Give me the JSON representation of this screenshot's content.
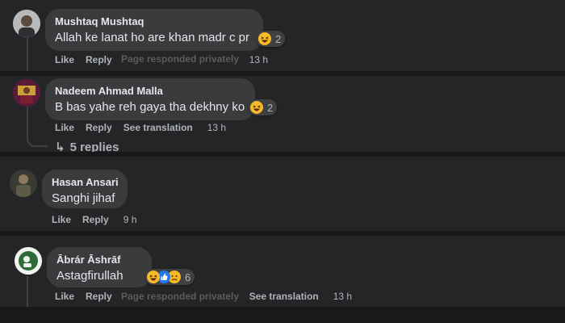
{
  "comments": [
    {
      "author": "Mushtaq Mushtaq",
      "text": "Allah ke lanat ho are khan madr c pr",
      "reaction_count": "2",
      "actions": {
        "like": "Like",
        "reply": "Reply",
        "time": "13 h"
      },
      "ghost": "Page responded privately"
    },
    {
      "author": "Nadeem Ahmad Malla",
      "text": "B bas yahe reh gaya tha dekhny ko",
      "reaction_count": "2",
      "actions": {
        "like": "Like",
        "reply": "Reply",
        "translation": "See translation",
        "time": "13 h"
      },
      "replies_label": "5 replies"
    },
    {
      "author": "Hasan Ansari",
      "text": "Sanghi jihaf",
      "actions": {
        "like": "Like",
        "reply": "Reply",
        "time": "9 h"
      }
    },
    {
      "author": "Ābrár Āshrāf",
      "text": "Astagfirullah",
      "reaction_count": "6",
      "actions": {
        "like": "Like",
        "reply": "Reply",
        "translation": "See translation",
        "time": "13 h"
      },
      "ghost": "Page responded privately"
    }
  ],
  "colors": {
    "background": "#242526",
    "bubble": "#3a3b3c",
    "secondary_text": "#b0b3b8",
    "like_blue": "#2078f4",
    "haha_yellow": "#f7b928"
  },
  "icons": {
    "haha": "haha-emoji-icon",
    "sad": "sad-emoji-icon",
    "like": "thumbs-up-icon",
    "reply_arrow": "reply-arrow-icon"
  }
}
